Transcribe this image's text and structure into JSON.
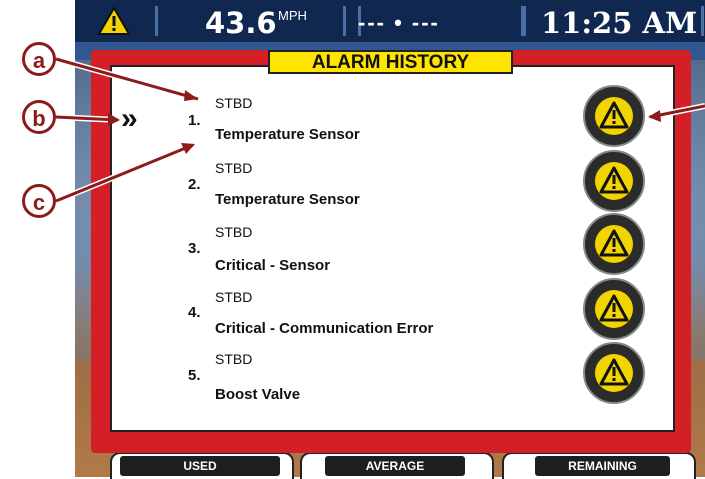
{
  "status_bar": {
    "speed": "43.6",
    "speed_unit": "MPH",
    "middle_readout": "--- • ---",
    "time": "11:25 AM"
  },
  "alarm_history": {
    "title": "ALARM HISTORY",
    "items": [
      {
        "number": "1.",
        "source": "STBD",
        "message": "Temperature Sensor"
      },
      {
        "number": "2.",
        "source": "STBD",
        "message": "Temperature Sensor"
      },
      {
        "number": "3.",
        "source": "STBD",
        "message": "Critical - Sensor"
      },
      {
        "number": "4.",
        "source": "STBD",
        "message": "Critical - Communication Error"
      },
      {
        "number": "5.",
        "source": "STBD",
        "message": "Boost Valve"
      }
    ],
    "selection_indicator": "»"
  },
  "bottom_tabs": [
    "USED",
    "AVERAGE",
    "REMAINING"
  ],
  "callouts": [
    "a",
    "b",
    "c"
  ],
  "icons": {
    "status_warning": "warning-triangle-icon",
    "alarm": "alarm-warning-icon",
    "selector": "double-chevron-right-icon"
  },
  "colors": {
    "frame": "#d51f26",
    "title_bg": "#ffe400",
    "alarm_icon": "#f2d400",
    "callout": "#8c1c1c"
  }
}
